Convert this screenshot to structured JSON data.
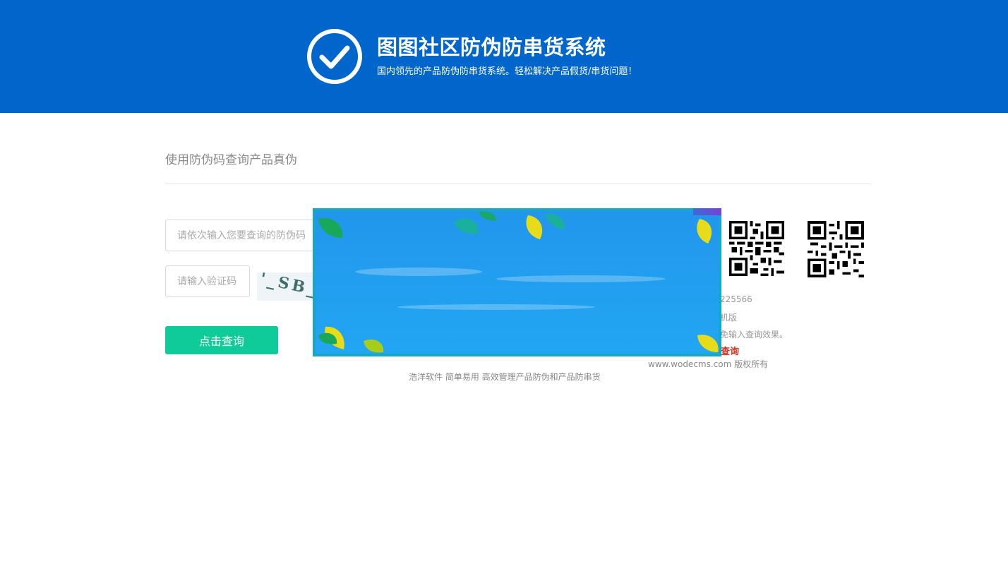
{
  "header": {
    "title": "图图社区防伪防串货系统",
    "subtitle": "国内领先的产品防伪防串货系统。轻松解决产品假货/串货问题！",
    "logo_icon": "check-circle-icon",
    "background_color": "#0066cc"
  },
  "query": {
    "section_title": "使用防伪码查询产品真伪",
    "code_placeholder": "请依次输入您要查询的防伪码",
    "verify_placeholder": "请输入验证码",
    "captcha_text": "'_SB_",
    "submit_label": "点击查询",
    "submit_color": "#0fcb99"
  },
  "sidebar_info": {
    "qr_codes": [
      "qr-code-icon",
      "qr-code-icon"
    ],
    "phone_fragment": "225566",
    "mobile_fragment": "机版",
    "hint_fragment": "免输入查询效果。",
    "link_fragment": "查询",
    "link_color": "#cc3322"
  },
  "footer": {
    "copyright": "www.wodecms.com 版权所有",
    "slogan": "浩洋软件 简单易用 高效管理产品防伪和产品防串货"
  },
  "popup": {
    "description_icon": "leaf-decoration-icon"
  }
}
